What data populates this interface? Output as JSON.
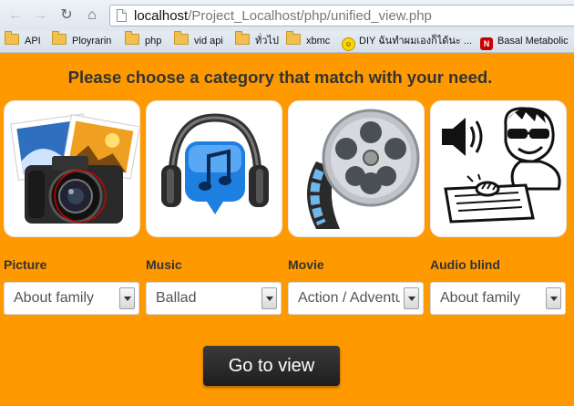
{
  "browser": {
    "url_host": "localhost",
    "url_path": "/Project_Localhost/php/unified_view.php",
    "bookmarks": [
      {
        "label": "API",
        "icon": "folder-icon"
      },
      {
        "label": "Ployrarin",
        "icon": "folder-icon"
      },
      {
        "label": "php",
        "icon": "folder-icon"
      },
      {
        "label": "vid api",
        "icon": "folder-icon"
      },
      {
        "label": "ทั่วไป",
        "icon": "folder-icon"
      },
      {
        "label": "xbmc",
        "icon": "folder-icon"
      },
      {
        "label": "DIY ฉันทำผมเองก็ได้นะ ...",
        "icon": "smiley-icon"
      },
      {
        "label": "Basal Metabolic",
        "icon": "n-badge-icon"
      }
    ],
    "colors": {
      "page_bg": "#ff9900",
      "button_bg": "#2a2a2a"
    }
  },
  "page": {
    "heading": "Please choose a category that match with your need.",
    "button_label": "Go to view",
    "categories": [
      {
        "label": "Picture",
        "selected": "About family",
        "icon": "camera-photo-icon"
      },
      {
        "label": "Music",
        "selected": "Ballad",
        "icon": "headphones-music-icon"
      },
      {
        "label": "Movie",
        "selected": "Action / Adventure",
        "icon": "film-reel-icon"
      },
      {
        "label": "Audio blind",
        "selected": "About family",
        "icon": "speaker-reader-icon"
      }
    ]
  }
}
